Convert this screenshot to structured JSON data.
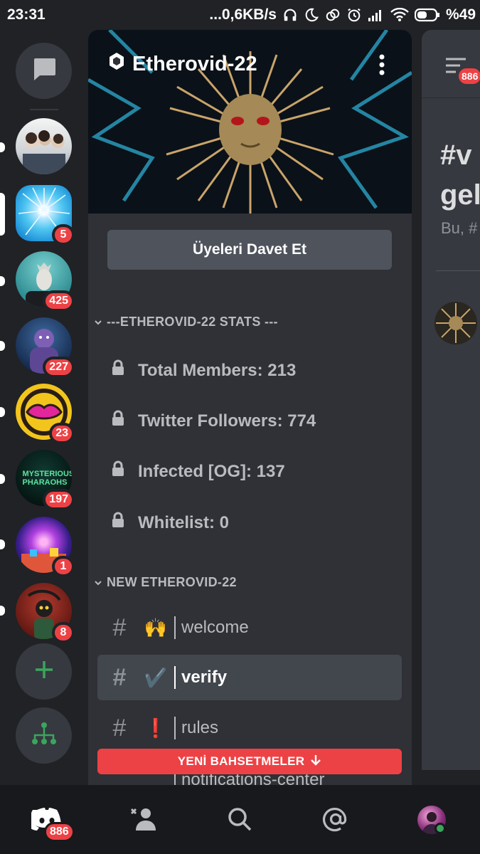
{
  "status_bar": {
    "time": "23:31",
    "net_speed": "...0,6KB/s",
    "battery": "%49",
    "icons": [
      "headphones-icon",
      "moon-icon",
      "link-icon",
      "alarm-icon",
      "signal-icon",
      "wifi-icon",
      "battery-icon"
    ]
  },
  "rail": {
    "dm_icon": "chat-bubble-icon",
    "servers": [
      {
        "name": "group-photo",
        "badge": "",
        "unread": true
      },
      {
        "name": "etherovid-22",
        "badge": "5",
        "selected": true
      },
      {
        "name": "goat-server",
        "badge": "425",
        "unread": true
      },
      {
        "name": "bear-server",
        "badge": "227",
        "unread": true
      },
      {
        "name": "lips-server",
        "badge": "23",
        "unread": true
      },
      {
        "name": "mysterious-pharaohs",
        "badge": "197",
        "unread": true,
        "logo_text": "MYSTERIOUS PHARAOHS"
      },
      {
        "name": "neon-server",
        "badge": "1",
        "unread": true
      },
      {
        "name": "reaper-server",
        "badge": "8",
        "unread": true
      }
    ],
    "add_icon": "plus-icon",
    "discover_icon": "hierarchy-icon"
  },
  "panel": {
    "server_name": "Etherovid-22",
    "invite_label": "Üyeleri Davet Et",
    "stats_category": "---ETHEROVID-22 STATS ---",
    "stats": [
      {
        "label": "Total Members: 213"
      },
      {
        "label": "Twitter Followers: 774"
      },
      {
        "label": "Infected [OG]: 137"
      },
      {
        "label": "Whitelist: 0"
      }
    ],
    "channels_category": "NEW ETHEROVID-22",
    "channels": [
      {
        "emoji": "🙌",
        "name": "welcome",
        "active": false
      },
      {
        "emoji": "✔️",
        "name": "verify",
        "active": true
      },
      {
        "emoji": "❗",
        "name": "rules",
        "active": false
      }
    ],
    "peek_channel": "notifications-center",
    "new_mentions_label": "YENİ BAHSETMELER"
  },
  "chat": {
    "badge": "886",
    "title_line1": "#v",
    "title_line2": "gel",
    "subtitle": "Bu, #"
  },
  "bottom_nav": {
    "home_badge": "886",
    "items": [
      "home-icon",
      "friends-icon",
      "search-icon",
      "mentions-icon",
      "profile-avatar"
    ]
  },
  "colors": {
    "mention_red": "#ed4245",
    "online_green": "#3ba55d",
    "add_green": "#3ba55d"
  }
}
